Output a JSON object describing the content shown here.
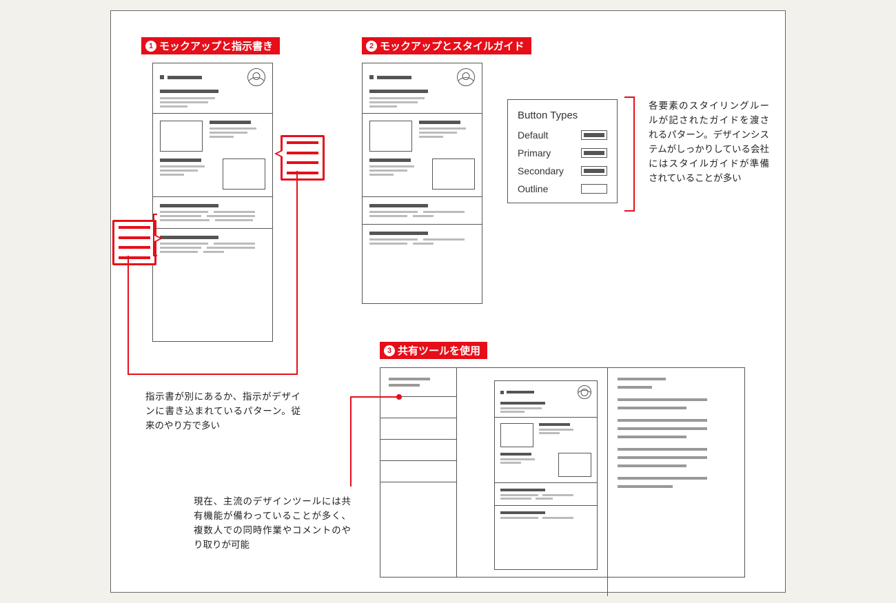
{
  "labels": {
    "one": "モックアップと指示書き",
    "two": "モックアップとスタイルガイド",
    "three": "共有ツールを使用"
  },
  "captions": {
    "one": "指示書が別にあるか、指示がデザインに書き込まれているパターン。従来のやり方で多い",
    "two": "各要素のスタイリングルールが記されたガイドを渡されるパターン。デザインシステムがしっかりしている会社にはスタイルガイドが準備されていることが多い",
    "three": "現在、主流のデザインツールには共有機能が備わっていることが多く、複数人での同時作業やコメントのやり取りが可能"
  },
  "styleguide": {
    "title": "Button Types",
    "rows": [
      "Default",
      "Primary",
      "Secondary",
      "Outline"
    ]
  }
}
